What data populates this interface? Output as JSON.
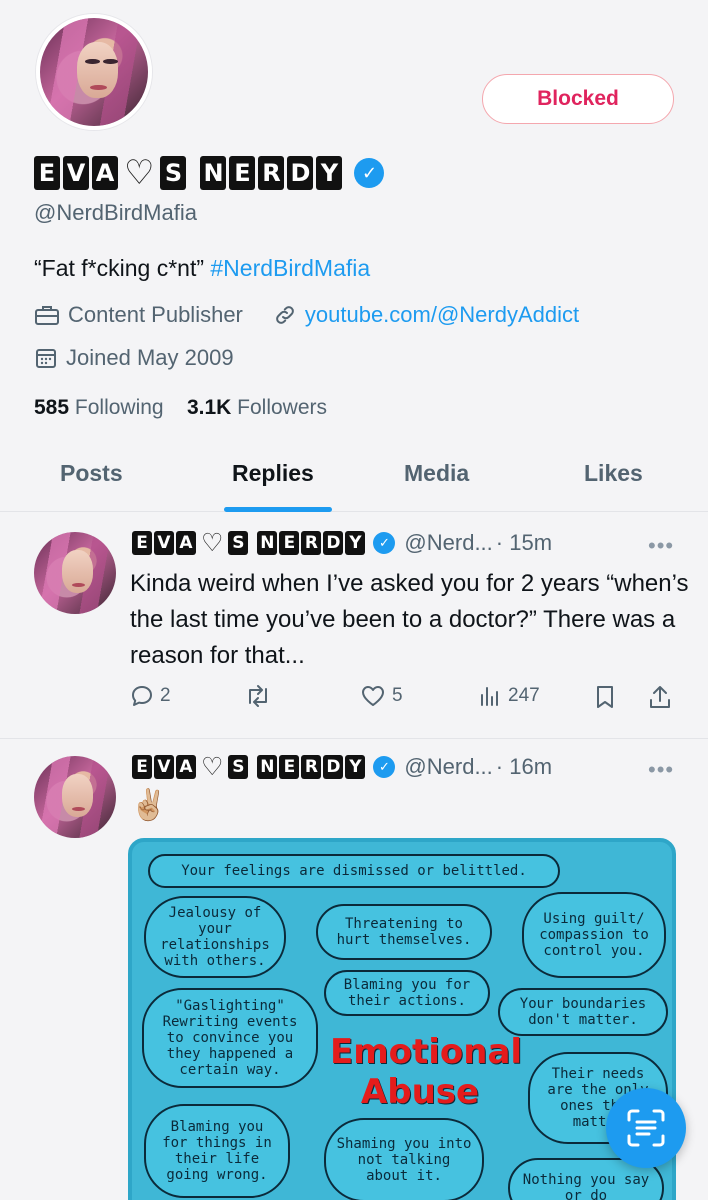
{
  "profile": {
    "name_left": [
      "E",
      "V",
      "A"
    ],
    "name_right": [
      "S"
    ],
    "name_end": [
      "N",
      "E",
      "R",
      "D",
      "Y"
    ],
    "heart": "♡",
    "handle": "@NerdBirdMafia",
    "blocked_label": "Blocked",
    "bio_text": "“Fat f*cking c*nt”",
    "bio_hashtag": "#NerdBirdMafia",
    "category": "Content Publisher",
    "website": "youtube.com/@NerdyAddict",
    "joined": "Joined May 2009",
    "following_count": "585",
    "following_label": "Following",
    "followers_count": "3.1K",
    "followers_label": "Followers"
  },
  "tabs": [
    "Posts",
    "Replies",
    "Media",
    "Likes"
  ],
  "active_tab": "Replies",
  "tweets": [
    {
      "handle": "@Nerd...",
      "time": "· 15m",
      "text": "Kinda weird when I’ve asked you for 2 years “when’s the last time you’ve been to a doctor?” There was a reason for that...",
      "replies": "2",
      "likes": "5",
      "views": "247"
    },
    {
      "handle": "@Nerd...",
      "time": "· 16m",
      "text": "✌🏼"
    }
  ],
  "media": {
    "title_line1": "Emotional",
    "title_line2": "Abuse",
    "bubbles": {
      "b1": "Your feelings are dismissed or belittled.",
      "b2": "Jealousy of your relationships with others.",
      "b3": "Threatening to hurt themselves.",
      "b4": "Using guilt/ compassion to control you.",
      "b5": "Blaming you for their actions.",
      "b6": "\"Gaslighting\" Rewriting events to convince you they happened a certain way.",
      "b7": "Your boundaries don't matter.",
      "b8": "Their needs are the only ones that matter",
      "b9": "Blaming you for things in their life going wrong.",
      "b10": "Shaming you into not talking about it.",
      "b11": "Nothing you say or do"
    }
  },
  "icons": {
    "verified": "verified-badge-icon",
    "category": "briefcase-icon",
    "website": "link-icon",
    "joined": "calendar-icon",
    "reply": "reply-icon",
    "repost": "repost-icon",
    "like": "heart-icon",
    "views": "views-icon",
    "bookmark": "bookmark-icon",
    "share": "share-icon",
    "lens": "scan-text-icon"
  },
  "colors": {
    "accent": "#1d9bf0",
    "blocked": "#e0245e",
    "media_bg": "#3fb7d6",
    "media_title": "#e41c1c"
  }
}
